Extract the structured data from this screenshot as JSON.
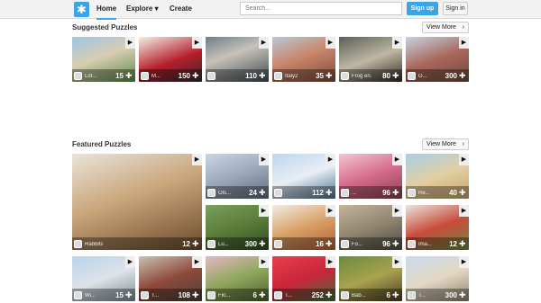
{
  "header": {
    "logo_icon": "puzzle-piece-icon",
    "nav": [
      {
        "label": "Home"
      },
      {
        "label": "Explore",
        "caret": "▾"
      },
      {
        "label": "Create"
      }
    ],
    "search_placeholder": "Search...",
    "signup_label": "Sign up",
    "signin_label": "Sign in"
  },
  "suggested": {
    "title": "Suggested Puzzles",
    "view_more": "View More",
    "puzzles": [
      {
        "title": "Lof...",
        "count": "15"
      },
      {
        "title": "M...",
        "count": "150"
      },
      {
        "title": "",
        "count": "110"
      },
      {
        "title": "Italy2",
        "count": "35"
      },
      {
        "title": "Frog en...",
        "count": "80"
      },
      {
        "title": "G...",
        "count": "300"
      }
    ]
  },
  "featured": {
    "title": "Featured Puzzles",
    "view_more": "View More",
    "puzzles": [
      {
        "title": "Rabbits",
        "count": "12"
      },
      {
        "title": "Ols...",
        "count": "24"
      },
      {
        "title": "",
        "count": "112"
      },
      {
        "title": "...",
        "count": "96"
      },
      {
        "title": "Re...",
        "count": "40"
      },
      {
        "title": "Lu...",
        "count": "300"
      },
      {
        "title": "",
        "count": "16"
      },
      {
        "title": "Fo...",
        "count": "96"
      },
      {
        "title": "Ima...",
        "count": "12"
      },
      {
        "title": "Wi...",
        "count": "15"
      },
      {
        "title": "T...",
        "count": "108"
      },
      {
        "title": "Flo...",
        "count": "6"
      },
      {
        "title": "T...",
        "count": "252"
      },
      {
        "title": "Bab...",
        "count": "6"
      },
      {
        "title": "T...",
        "count": "300"
      }
    ]
  },
  "colors": {
    "accent": "#3aa4e6"
  }
}
